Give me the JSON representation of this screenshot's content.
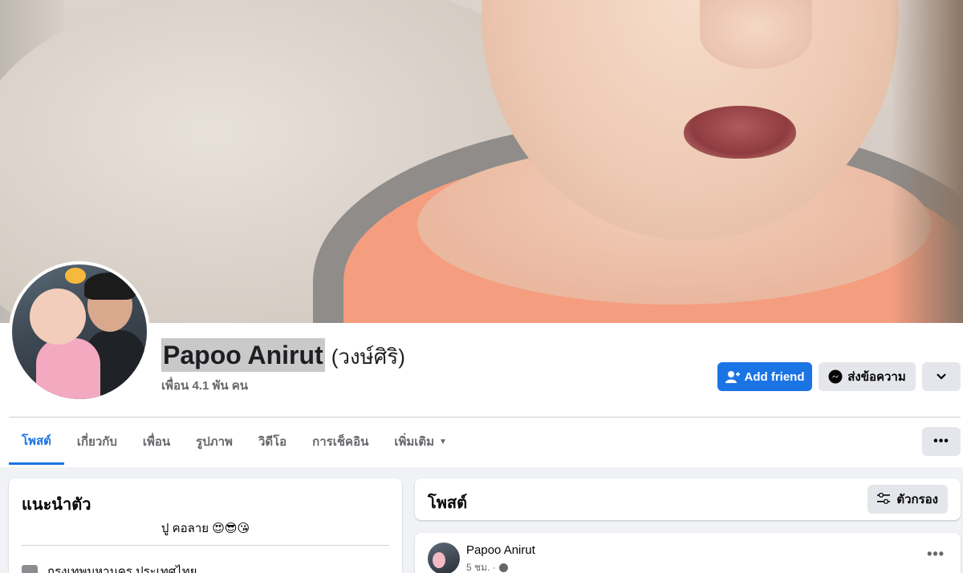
{
  "profile": {
    "name": "Papoo Anirut",
    "alt_name": "(วงษ์ศิริ)",
    "friends_count": "เพื่อน 4.1 พัน คน"
  },
  "actions": {
    "add_friend": "Add friend",
    "message": "ส่งข้อความ",
    "add_friend_icon": "add-user-icon",
    "message_icon": "messenger-icon",
    "more_icon": "chevron-down-icon"
  },
  "tabs": [
    {
      "label": "โพสต์",
      "active": true
    },
    {
      "label": "เกี่ยวกับ",
      "active": false
    },
    {
      "label": "เพื่อน",
      "active": false
    },
    {
      "label": "รูปภาพ",
      "active": false
    },
    {
      "label": "วิดีโอ",
      "active": false
    },
    {
      "label": "การเช็คอิน",
      "active": false
    },
    {
      "label": "เพิ่มเติม",
      "active": false
    }
  ],
  "tab_more_dots": "•••",
  "intro": {
    "title": "แนะนำตัว",
    "bio": "ปู คอลาย 😍😎😘",
    "location": "กรุงเทพมหานคร ประเทศไทย"
  },
  "posts": {
    "title": "โพสต์",
    "filter_label": "ตัวกรอง"
  },
  "post": {
    "author": "Papoo Anirut",
    "time": "5 ชม. ·",
    "more_dots": "•••"
  },
  "colors": {
    "primary": "#1b74e4",
    "button_bg": "#e4e6eb",
    "page_bg": "#f0f2f5"
  }
}
